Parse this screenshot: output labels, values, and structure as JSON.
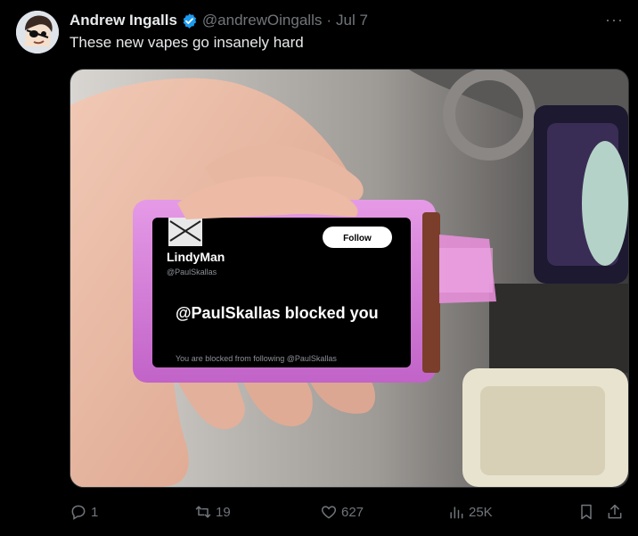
{
  "tweet": {
    "author_name": "Andrew Ingalls",
    "author_handle": "@andrewOingalls",
    "separator": "·",
    "date": "Jul 7",
    "text": "These new vapes go insanely hard",
    "more": "···"
  },
  "screen": {
    "follow_label": "Follow",
    "profile_name": "LindyMan",
    "profile_handle": "@PaulSkallas",
    "blocked_title": "@PaulSkallas blocked you",
    "blocked_subtitle": "You are blocked from following @PaulSkallas"
  },
  "actions": {
    "replies": "1",
    "reposts": "19",
    "likes": "627",
    "views": "25K"
  },
  "colors": {
    "verified": "#1d9bf0",
    "vape_body": "#d47ad8",
    "muted": "#71767b"
  }
}
